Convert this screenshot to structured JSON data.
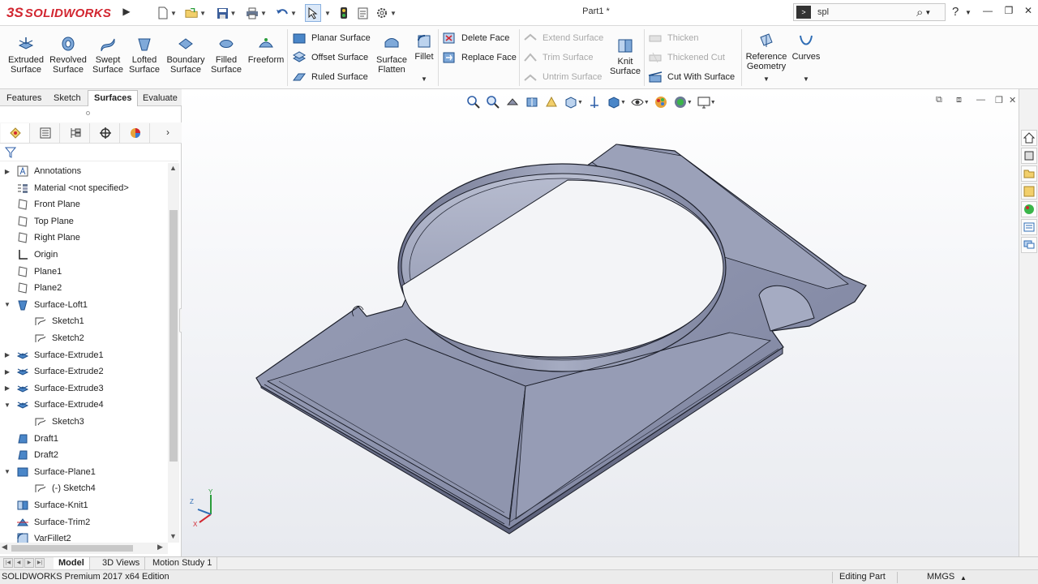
{
  "titlebar": {
    "logo_ds": "3S",
    "logo_brand": "SOLIDWORKS",
    "document_title": "Part1 *",
    "search_value": "spl",
    "search_cmd_icon": "command-prompt-icon",
    "help_label": "?"
  },
  "ribbon": {
    "big_buttons": [
      {
        "label": "Extruded Surface",
        "icon": "extruded-surface-icon"
      },
      {
        "label": "Revolved Surface",
        "icon": "revolved-surface-icon"
      },
      {
        "label": "Swept Surface",
        "icon": "swept-surface-icon"
      },
      {
        "label": "Lofted Surface",
        "icon": "lofted-surface-icon"
      },
      {
        "label": "Boundary Surface",
        "icon": "boundary-surface-icon"
      },
      {
        "label": "Filled Surface",
        "icon": "filled-surface-icon"
      },
      {
        "label": "Freeform",
        "icon": "freeform-icon"
      }
    ],
    "surface_group": [
      "Planar Surface",
      "Offset Surface",
      "Ruled Surface"
    ],
    "surface_flatten": "Surface Flatten",
    "fillet": "Fillet",
    "face_group": [
      "Delete Face",
      "Replace Face"
    ],
    "edit_group": [
      "Extend Surface",
      "Trim Surface",
      "Untrim Surface"
    ],
    "knit_surface": "Knit Surface",
    "thicken_group": [
      "Thicken",
      "Thickened Cut",
      "Cut With Surface"
    ],
    "reference_geometry": "Reference Geometry",
    "curves": "Curves"
  },
  "command_tabs": [
    "Features",
    "Sketch",
    "Surfaces",
    "Evaluate"
  ],
  "active_command_tab": "Surfaces",
  "feature_tree": [
    {
      "label": "Annotations",
      "icon": "annotations-icon",
      "expander": "▶",
      "indent": 0
    },
    {
      "label": "Material <not specified>",
      "icon": "material-icon",
      "expander": "",
      "indent": 0
    },
    {
      "label": "Front Plane",
      "icon": "plane-icon",
      "expander": "",
      "indent": 0
    },
    {
      "label": "Top Plane",
      "icon": "plane-icon",
      "expander": "",
      "indent": 0
    },
    {
      "label": "Right Plane",
      "icon": "plane-icon",
      "expander": "",
      "indent": 0
    },
    {
      "label": "Origin",
      "icon": "origin-icon",
      "expander": "",
      "indent": 0
    },
    {
      "label": "Plane1",
      "icon": "plane-icon",
      "expander": "",
      "indent": 0
    },
    {
      "label": "Plane2",
      "icon": "plane-icon",
      "expander": "",
      "indent": 0
    },
    {
      "label": "Surface-Loft1",
      "icon": "surface-loft-icon",
      "expander": "▼",
      "indent": 0
    },
    {
      "label": "Sketch1",
      "icon": "sketch-icon",
      "expander": "",
      "indent": 1
    },
    {
      "label": "Sketch2",
      "icon": "sketch-icon",
      "expander": "",
      "indent": 1
    },
    {
      "label": "Surface-Extrude1",
      "icon": "surface-extrude-icon",
      "expander": "▶",
      "indent": 0
    },
    {
      "label": "Surface-Extrude2",
      "icon": "surface-extrude-icon",
      "expander": "▶",
      "indent": 0
    },
    {
      "label": "Surface-Extrude3",
      "icon": "surface-extrude-icon",
      "expander": "▶",
      "indent": 0
    },
    {
      "label": "Surface-Extrude4",
      "icon": "surface-extrude-icon",
      "expander": "▼",
      "indent": 0
    },
    {
      "label": "Sketch3",
      "icon": "sketch-icon",
      "expander": "",
      "indent": 1
    },
    {
      "label": "Draft1",
      "icon": "draft-icon",
      "expander": "",
      "indent": 0
    },
    {
      "label": "Draft2",
      "icon": "draft-icon",
      "expander": "",
      "indent": 0
    },
    {
      "label": "Surface-Plane1",
      "icon": "surface-plane-icon",
      "expander": "▼",
      "indent": 0
    },
    {
      "label": "(-) Sketch4",
      "icon": "sketch-icon",
      "expander": "",
      "indent": 1
    },
    {
      "label": "Surface-Knit1",
      "icon": "surface-knit-icon",
      "expander": "",
      "indent": 0
    },
    {
      "label": "Surface-Trim2",
      "icon": "surface-trim-icon",
      "expander": "",
      "indent": 0
    },
    {
      "label": "VarFillet2",
      "icon": "fillet-icon",
      "expander": "",
      "indent": 0
    }
  ],
  "bottom_tabs": [
    "Model",
    "3D Views",
    "Motion Study 1"
  ],
  "active_bottom_tab": "Model",
  "status": {
    "edition": "SOLIDWORKS Premium 2017 x64 Edition",
    "mode": "Editing Part",
    "units": "MMGS"
  },
  "triad": {
    "x": "X",
    "y": "Y",
    "z": "Z"
  },
  "colors": {
    "brand_red": "#d22630",
    "model_fill": "#8c92ab",
    "model_edge": "#1c1f2a",
    "accent_blue": "#2f6db5"
  }
}
